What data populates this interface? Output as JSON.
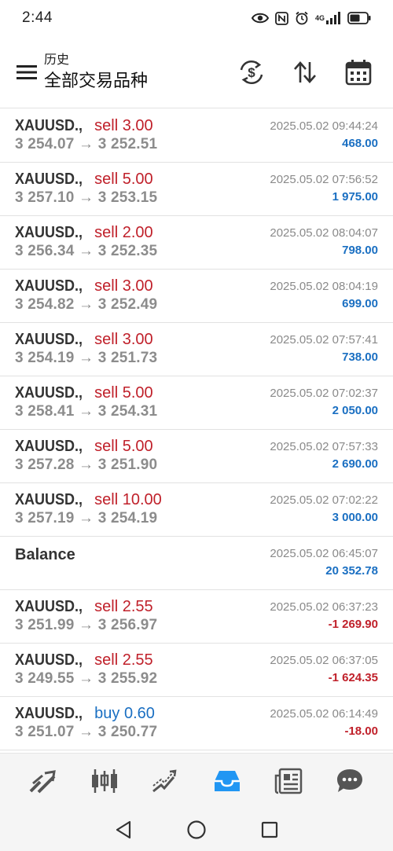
{
  "status_bar": {
    "time": "2:44",
    "network_label": "4G",
    "icons": [
      "eye-icon",
      "nfc-icon",
      "alarm-icon",
      "signal-icon",
      "battery-icon"
    ]
  },
  "header": {
    "subtitle": "历史",
    "title": "全部交易品种",
    "actions": [
      "swap-currency-icon",
      "sort-icon",
      "calendar-icon"
    ]
  },
  "trades": [
    {
      "type": "trade",
      "symbol": "XAUUSD.,",
      "side": "sell 3.00",
      "direction": "sell",
      "prices": "3 254.07 → 3 252.51",
      "time": "2025.05.02 09:44:24",
      "profit": "468.00",
      "positive": true
    },
    {
      "type": "trade",
      "symbol": "XAUUSD.,",
      "side": "sell 5.00",
      "direction": "sell",
      "prices": "3 257.10 → 3 253.15",
      "time": "2025.05.02 07:56:52",
      "profit": "1 975.00",
      "positive": true
    },
    {
      "type": "trade",
      "symbol": "XAUUSD.,",
      "side": "sell 2.00",
      "direction": "sell",
      "prices": "3 256.34 → 3 252.35",
      "time": "2025.05.02 08:04:07",
      "profit": "798.00",
      "positive": true
    },
    {
      "type": "trade",
      "symbol": "XAUUSD.,",
      "side": "sell 3.00",
      "direction": "sell",
      "prices": "3 254.82 → 3 252.49",
      "time": "2025.05.02 08:04:19",
      "profit": "699.00",
      "positive": true
    },
    {
      "type": "trade",
      "symbol": "XAUUSD.,",
      "side": "sell 3.00",
      "direction": "sell",
      "prices": "3 254.19 → 3 251.73",
      "time": "2025.05.02 07:57:41",
      "profit": "738.00",
      "positive": true
    },
    {
      "type": "trade",
      "symbol": "XAUUSD.,",
      "side": "sell 5.00",
      "direction": "sell",
      "prices": "3 258.41 → 3 254.31",
      "time": "2025.05.02 07:02:37",
      "profit": "2 050.00",
      "positive": true
    },
    {
      "type": "trade",
      "symbol": "XAUUSD.,",
      "side": "sell 5.00",
      "direction": "sell",
      "prices": "3 257.28 → 3 251.90",
      "time": "2025.05.02 07:57:33",
      "profit": "2 690.00",
      "positive": true
    },
    {
      "type": "trade",
      "symbol": "XAUUSD.,",
      "side": "sell 10.00",
      "direction": "sell",
      "prices": "3 257.19 → 3 254.19",
      "time": "2025.05.02 07:02:22",
      "profit": "3 000.00",
      "positive": true
    },
    {
      "type": "balance",
      "label": "Balance",
      "time": "2025.05.02 06:45:07",
      "profit": "20 352.78",
      "positive": true
    },
    {
      "type": "trade",
      "symbol": "XAUUSD.,",
      "side": "sell 2.55",
      "direction": "sell",
      "prices": "3 251.99 → 3 256.97",
      "time": "2025.05.02 06:37:23",
      "profit": "-1 269.90",
      "positive": false
    },
    {
      "type": "trade",
      "symbol": "XAUUSD.,",
      "side": "sell 2.55",
      "direction": "sell",
      "prices": "3 249.55 → 3 255.92",
      "time": "2025.05.02 06:37:05",
      "profit": "-1 624.35",
      "positive": false
    },
    {
      "type": "trade",
      "symbol": "XAUUSD.,",
      "side": "buy 0.60",
      "direction": "buy",
      "prices": "3 251.07 → 3 250.77",
      "time": "2025.05.02 06:14:49",
      "profit": "-18.00",
      "positive": false
    }
  ],
  "bottom_nav": {
    "items": [
      "quotes-icon",
      "chart-icon",
      "trade-icon",
      "history-icon",
      "news-icon",
      "chat-icon"
    ],
    "active": "history-icon",
    "active_color": "#2196f3"
  },
  "colors": {
    "sell": "#c0202a",
    "buy": "#1a6fc2",
    "profit_positive": "#1a6fc2",
    "profit_negative": "#c0202a"
  }
}
